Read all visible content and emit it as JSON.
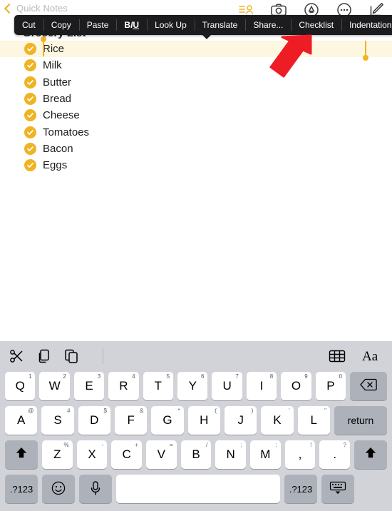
{
  "topbar": {
    "back_label": "Quick Notes",
    "back_icon": "chevron-left-icon",
    "icons": [
      {
        "name": "list-person-icon"
      },
      {
        "name": "camera-icon"
      },
      {
        "name": "markup-pen-circle-icon"
      },
      {
        "name": "more-ellipsis-circle-icon"
      },
      {
        "name": "compose-new-note-icon"
      }
    ]
  },
  "context_menu": {
    "items": [
      {
        "label": "Cut",
        "name": "cut"
      },
      {
        "label": "Copy",
        "name": "copy"
      },
      {
        "label": "Paste",
        "name": "paste"
      },
      {
        "label": "BIU",
        "name": "format",
        "bold": "B",
        "italic": "I",
        "underline": "U"
      },
      {
        "label": "Look Up",
        "name": "look-up"
      },
      {
        "label": "Translate",
        "name": "translate"
      },
      {
        "label": "Share...",
        "name": "share"
      },
      {
        "label": "Checklist",
        "name": "checklist"
      },
      {
        "label": "Indentation",
        "name": "indentation"
      }
    ]
  },
  "note": {
    "title": "Grocery List",
    "items": [
      {
        "text": "Rice",
        "checked": true,
        "selected": true
      },
      {
        "text": "Milk",
        "checked": true,
        "selected": false
      },
      {
        "text": "Butter",
        "checked": true,
        "selected": false
      },
      {
        "text": "Bread",
        "checked": true,
        "selected": false
      },
      {
        "text": "Cheese",
        "checked": true,
        "selected": false
      },
      {
        "text": "Tomatoes",
        "checked": true,
        "selected": false
      },
      {
        "text": "Bacon",
        "checked": true,
        "selected": false
      },
      {
        "text": "Eggs",
        "checked": true,
        "selected": false
      }
    ]
  },
  "annotation": {
    "arrow_color": "#ee1c25",
    "points_at": "Checklist"
  },
  "keyboard": {
    "toolbar": {
      "left": [
        {
          "name": "cut-scissors-icon"
        },
        {
          "name": "copy-icon"
        },
        {
          "name": "paste-icon"
        }
      ],
      "right": [
        {
          "name": "table-icon"
        },
        {
          "name": "text-format-aa-icon",
          "label": "Aa"
        }
      ]
    },
    "rows": [
      [
        {
          "main": "Q",
          "sub": "1"
        },
        {
          "main": "W",
          "sub": "2"
        },
        {
          "main": "E",
          "sub": "3"
        },
        {
          "main": "R",
          "sub": "4"
        },
        {
          "main": "T",
          "sub": "5"
        },
        {
          "main": "Y",
          "sub": "6"
        },
        {
          "main": "U",
          "sub": "7"
        },
        {
          "main": "I",
          "sub": "8"
        },
        {
          "main": "O",
          "sub": "9"
        },
        {
          "main": "P",
          "sub": "0"
        },
        {
          "main": "",
          "sub": "",
          "name": "backspace-key",
          "icon": "backspace-icon",
          "dark": true
        }
      ],
      [
        {
          "main": "A",
          "sub": "@"
        },
        {
          "main": "S",
          "sub": "#"
        },
        {
          "main": "D",
          "sub": "$"
        },
        {
          "main": "F",
          "sub": "&"
        },
        {
          "main": "G",
          "sub": "*"
        },
        {
          "main": "H",
          "sub": "("
        },
        {
          "main": "J",
          "sub": ")"
        },
        {
          "main": "K",
          "sub": "'"
        },
        {
          "main": "L",
          "sub": "\""
        },
        {
          "main": "return",
          "sub": "",
          "name": "return-key",
          "dark": true
        }
      ],
      [
        {
          "main": "",
          "sub": "",
          "name": "shift-key-left",
          "icon": "shift-arrow-icon",
          "dark": true
        },
        {
          "main": "Z",
          "sub": "%"
        },
        {
          "main": "X",
          "sub": "-"
        },
        {
          "main": "C",
          "sub": "+"
        },
        {
          "main": "V",
          "sub": "="
        },
        {
          "main": "B",
          "sub": "/"
        },
        {
          "main": "N",
          "sub": ";"
        },
        {
          "main": "M",
          "sub": ":"
        },
        {
          "main": ",",
          "sub": "!"
        },
        {
          "main": ".",
          "sub": "?"
        },
        {
          "main": "",
          "sub": "",
          "name": "shift-key-right",
          "icon": "shift-arrow-icon",
          "dark": true
        }
      ],
      [
        {
          "main": ".?123",
          "sub": "",
          "name": "numbers-key-left",
          "dark": true
        },
        {
          "main": "",
          "sub": "",
          "name": "emoji-key",
          "icon": "emoji-smiley-icon",
          "dark": true
        },
        {
          "main": "",
          "sub": "",
          "name": "dictation-key",
          "icon": "microphone-icon",
          "dark": true
        },
        {
          "main": "",
          "sub": "",
          "name": "space-key"
        },
        {
          "main": ".?123",
          "sub": "",
          "name": "numbers-key-right",
          "dark": true
        },
        {
          "main": "",
          "sub": "",
          "name": "dismiss-keyboard-key",
          "icon": "keyboard-down-icon",
          "dark": true
        }
      ]
    ]
  }
}
